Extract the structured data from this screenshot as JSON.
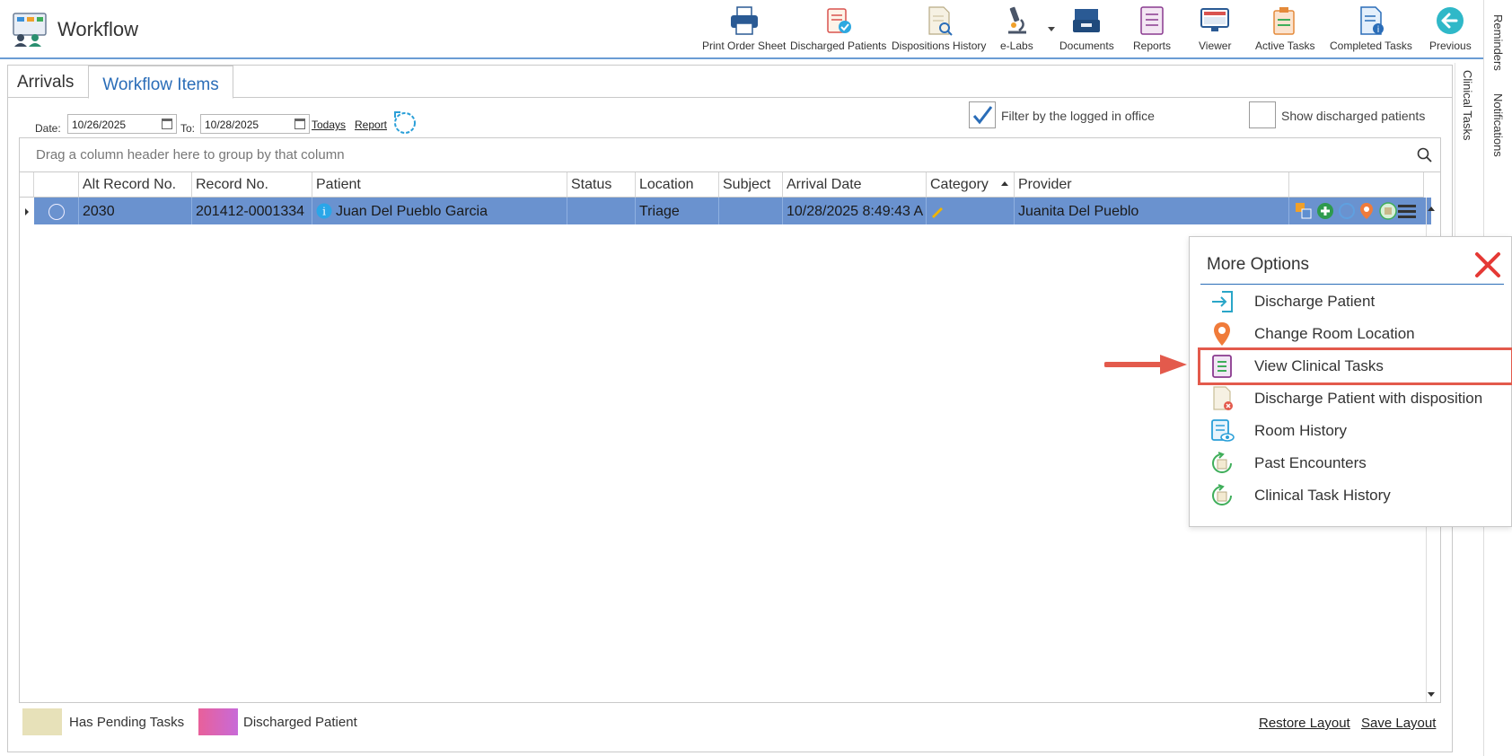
{
  "app": {
    "title": "Workflow"
  },
  "toolbar": {
    "items": [
      {
        "label": "Print Order Sheet",
        "icon": "printer-icon"
      },
      {
        "label": "Discharged Patients",
        "icon": "clipboard-check-icon"
      },
      {
        "label": "Dispositions History",
        "icon": "document-search-icon"
      },
      {
        "label": "e-Labs",
        "icon": "microscope-icon"
      },
      {
        "label": "Documents",
        "icon": "file-tray-icon"
      },
      {
        "label": "Reports",
        "icon": "report-icon"
      },
      {
        "label": "Viewer",
        "icon": "monitor-icon"
      },
      {
        "label": "Active Tasks",
        "icon": "active-tasks-icon"
      },
      {
        "label": "Completed Tasks",
        "icon": "completed-tasks-icon"
      },
      {
        "label": "Previous",
        "icon": "back-arrow-icon"
      }
    ]
  },
  "side_tabs": {
    "reminders": "Reminders",
    "notifications": "Notifications",
    "clinical_tasks": "Clinical Tasks"
  },
  "tabs": [
    {
      "label": "Arrivals"
    },
    {
      "label": "Workflow Items"
    }
  ],
  "filters": {
    "date_label": "Date:",
    "date_from": "10/26/2025",
    "to_label": "To:",
    "date_to": "10/28/2025",
    "todays_link": "Todays",
    "report_link": "Report",
    "filter_office_label": "Filter by the logged in office",
    "filter_office_checked": true,
    "show_discharged_label": "Show discharged patients",
    "show_discharged_checked": false
  },
  "grid": {
    "group_hint": "Drag a column header here to group by that column",
    "columns": [
      "Alt Record No.",
      "Record No.",
      "Patient",
      "Status",
      "Location",
      "Subject",
      "Arrival Date",
      "Category",
      "Provider"
    ],
    "rows": [
      {
        "alt_record": "2030",
        "record": "201412-0001334",
        "patient": "Juan Del Pueblo Garcia",
        "status": "",
        "location": "Triage",
        "subject": "",
        "arrival_date": "10/28/2025 8:49:43 A",
        "category": "",
        "provider": "Juanita Del Pueblo"
      }
    ]
  },
  "legend": {
    "pending_label": "Has Pending Tasks",
    "pending_color": "#e7e1b9",
    "discharged_label": "Discharged Patient",
    "discharged_color": "#e8609a"
  },
  "footer": {
    "restore_layout": "Restore Layout",
    "save_layout": "Save Layout"
  },
  "popup": {
    "title": "More Options",
    "items": [
      {
        "label": "Discharge Patient",
        "icon": "discharge-icon"
      },
      {
        "label": "Change Room Location",
        "icon": "map-pin-icon"
      },
      {
        "label": "View Clinical Tasks",
        "icon": "clinical-tasks-icon",
        "highlighted": true
      },
      {
        "label": "Discharge Patient with disposition",
        "icon": "document-x-icon"
      },
      {
        "label": "Room History",
        "icon": "history-eye-icon"
      },
      {
        "label": "Past Encounters",
        "icon": "encounters-icon"
      },
      {
        "label": "Clinical Task History",
        "icon": "task-history-icon"
      }
    ]
  },
  "colors": {
    "accent": "#2a6db8",
    "selected_row": "#6a92cf",
    "highlight_border": "#e35a4c"
  }
}
